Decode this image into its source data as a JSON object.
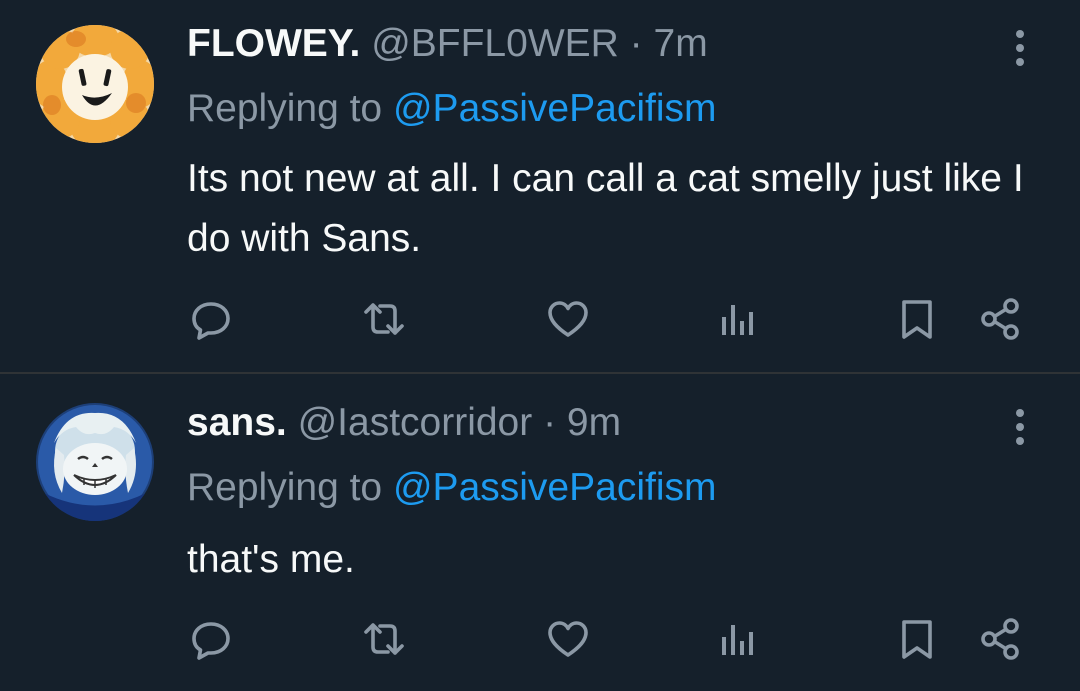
{
  "colors": {
    "background": "#15202b",
    "text_primary": "#f7f9f9",
    "text_secondary": "#8b98a5",
    "accent_link": "#1d9bf0",
    "divider": "#2f3336"
  },
  "tweets": [
    {
      "display_name": "FLOWEY.",
      "handle": "@BFFL0WER",
      "separator": "·",
      "time": "7m",
      "replying_prefix": "Replying to",
      "replying_to": "@PassivePacifism",
      "text": "Its not new at all. I can call a cat smelly just like I do with Sans.",
      "avatar_icon": "flower-face-avatar",
      "actions": [
        "reply-icon",
        "retweet-icon",
        "like-icon",
        "views-icon",
        "bookmark-icon",
        "share-icon"
      ]
    },
    {
      "display_name": "sans.",
      "handle": "@Iastcorridor",
      "separator": "·",
      "time": "9m",
      "replying_prefix": "Replying to",
      "replying_to": "@PassivePacifism",
      "text": "that's me.",
      "avatar_icon": "skeleton-face-avatar",
      "actions": [
        "reply-icon",
        "retweet-icon",
        "like-icon",
        "views-icon",
        "bookmark-icon",
        "share-icon"
      ]
    }
  ]
}
